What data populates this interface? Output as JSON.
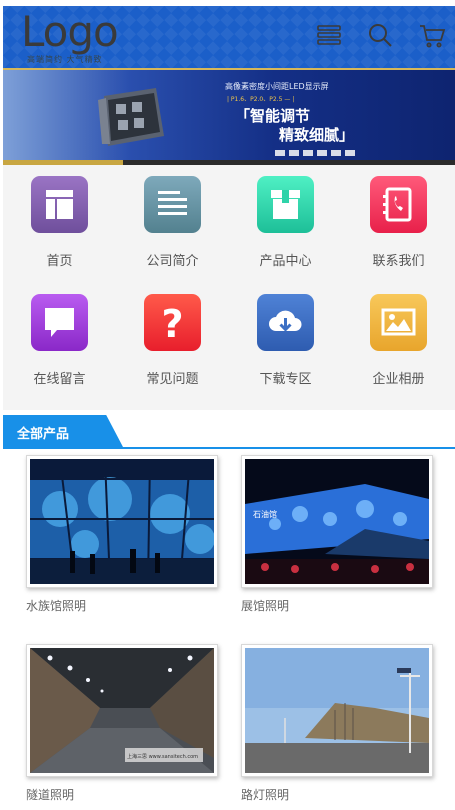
{
  "header": {
    "logo": "Logo",
    "logo_sub": "高端简约 大气精致",
    "icons": [
      "menu-icon",
      "search-icon",
      "cart-icon"
    ]
  },
  "banner": {
    "title": "高像素密度小间距LED显示屏",
    "spec": "| P1.6、P2.0、P2.5 — |",
    "headline_1": "「智能调节",
    "headline_2": "精致细腻」"
  },
  "nav": {
    "items": [
      {
        "label": "首页",
        "icon": "home-icon",
        "color": "#7b5ca6"
      },
      {
        "label": "公司简介",
        "icon": "profile-icon",
        "color": "#5f8ea0"
      },
      {
        "label": "产品中心",
        "icon": "box-icon",
        "color": "#2fd3a9"
      },
      {
        "label": "联系我们",
        "icon": "phone-book-icon",
        "color": "#f03a5f"
      },
      {
        "label": "在线留言",
        "icon": "message-icon",
        "color": "#9b34d8"
      },
      {
        "label": "常见问题",
        "icon": "question-icon",
        "color": "#f5383a"
      },
      {
        "label": "下载专区",
        "icon": "cloud-download-icon",
        "color": "#3b6fc4"
      },
      {
        "label": "企业相册",
        "icon": "photo-icon",
        "color": "#f0b840"
      }
    ]
  },
  "section": {
    "title": "全部产品"
  },
  "products": [
    {
      "label": "水族馆照明"
    },
    {
      "label": "展馆照明",
      "sign": "石油馆"
    },
    {
      "label": "隧道照明",
      "watermark": "上海三思 www.sansitech.com"
    },
    {
      "label": "路灯照明"
    }
  ]
}
